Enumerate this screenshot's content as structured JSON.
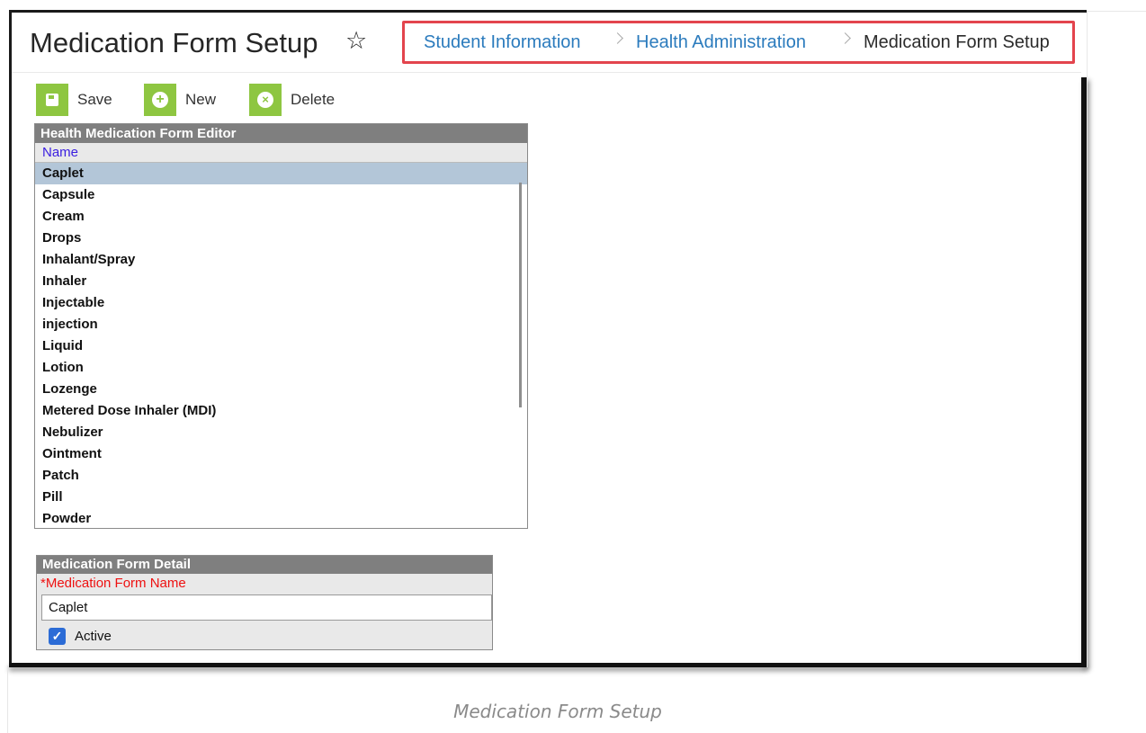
{
  "header": {
    "title": "Medication Form Setup",
    "star_icon": "star-icon",
    "breadcrumb": [
      {
        "label": "Student Information"
      },
      {
        "label": "Health Administration"
      },
      {
        "label": "Medication Form Setup"
      }
    ],
    "highlight_color": "#e3444d"
  },
  "toolbar": {
    "save_label": "Save",
    "new_label": "New",
    "delete_label": "Delete",
    "button_color": "#8ec641"
  },
  "editor": {
    "title": "Health Medication Form Editor",
    "column_header": "Name",
    "selected": "Caplet",
    "items": [
      "Caplet",
      "Capsule",
      "Cream",
      "Drops",
      "Inhalant/Spray",
      "Inhaler",
      "Injectable",
      "injection",
      "Liquid",
      "Lotion",
      "Lozenge",
      "Metered Dose Inhaler (MDI)",
      "Nebulizer",
      "Ointment",
      "Patch",
      "Pill",
      "Powder"
    ]
  },
  "detail": {
    "title": "Medication Form Detail",
    "field_label": "*Medication Form Name",
    "field_value": "Caplet",
    "active_label": "Active",
    "active_checked": true
  },
  "caption": "Medication Form Setup"
}
